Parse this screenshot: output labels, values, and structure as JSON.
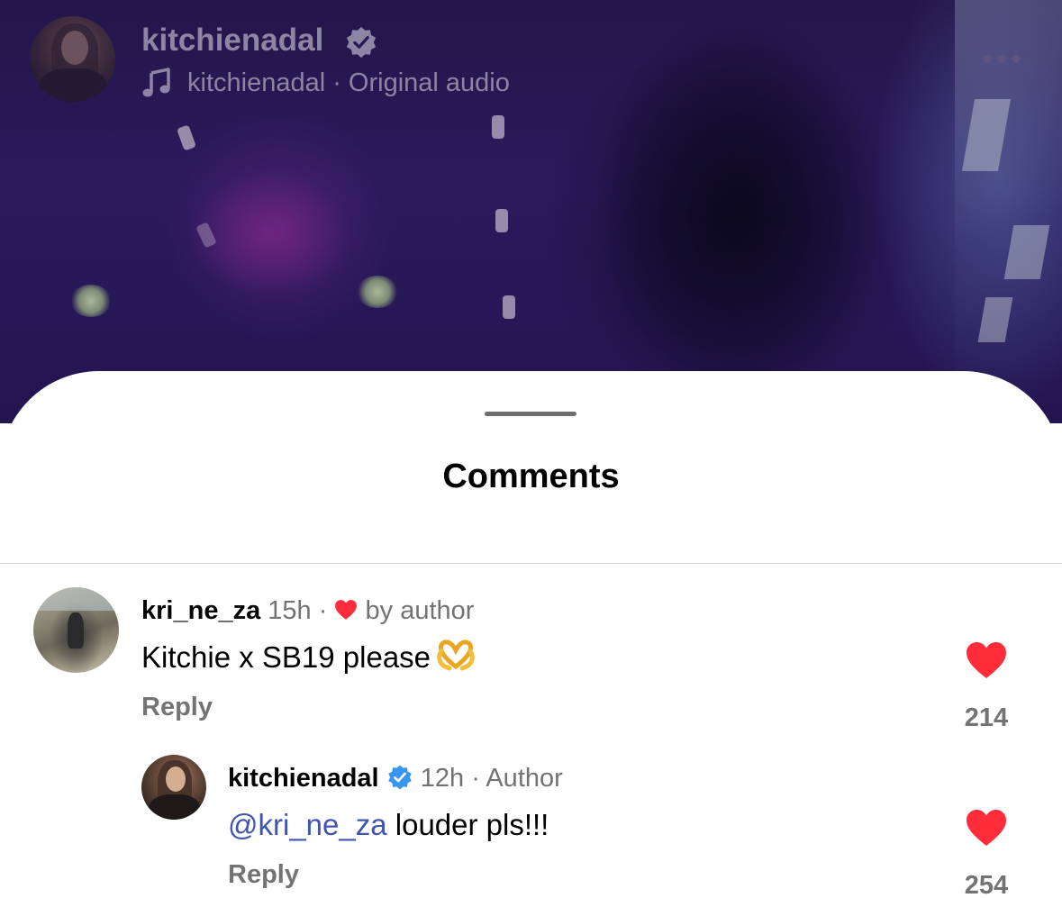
{
  "reel": {
    "username": "kitchienadal",
    "audio_label": "kitchienadal · Original audio"
  },
  "sheet": {
    "title": "Comments"
  },
  "comments": [
    {
      "username": "kri_ne_za",
      "time": "15h",
      "separator": "·",
      "liked_by_author_label": "by author",
      "text": "Kitchie x SB19 please",
      "emoji_icon": "heart-hands-emoji",
      "reply_label": "Reply",
      "likes": "214"
    },
    {
      "username": "kitchienadal",
      "time": "12h",
      "separator": "·",
      "role_label": "Author",
      "mention": "@kri_ne_za",
      "text": " louder pls!!!",
      "reply_label": "Reply",
      "likes": "254"
    }
  ],
  "colors": {
    "heart_red": "#ff2d3a",
    "verified_blue": "#3797f0",
    "mention_blue": "#4054b2",
    "secondary_text": "#737373"
  }
}
